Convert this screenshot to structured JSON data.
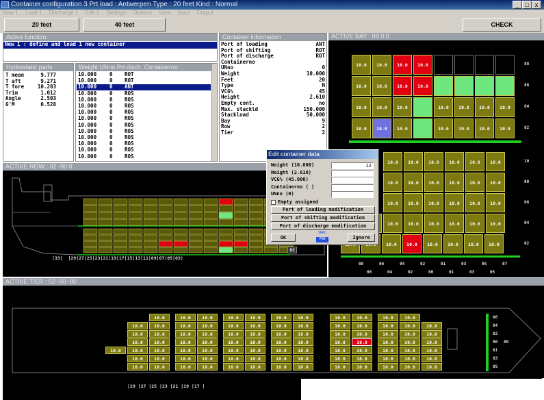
{
  "window": {
    "title": "Container configuration 3  Prt load : Antwerpen  Type : 20 feet  Kind : Normal",
    "controls": [
      "_",
      "□",
      "x"
    ]
  },
  "menu": [
    "New 1",
    "Load 1",
    "Discharge 1",
    "Edit 1",
    "Settings",
    "Options",
    "View",
    "Input",
    "Output"
  ],
  "toolbar": {
    "btn20": "20 feet",
    "btn40": "40 feet",
    "check": "CHECK"
  },
  "active_function": {
    "header": "Active function",
    "text": "New 1 : define and load 1 new container"
  },
  "hydro": {
    "header": "Hydrostatic parts",
    "rows": [
      {
        "k": "T mean",
        "v": "9.777"
      },
      {
        "k": "T aft",
        "v": "9.271"
      },
      {
        "k": "T fore",
        "v": "10.283"
      },
      {
        "k": "Trim",
        "v": "1.012"
      },
      {
        "k": "Angle",
        "v": "2.503"
      },
      {
        "k": "G'M",
        "v": "0.528"
      }
    ]
  },
  "weights": {
    "header": "Weight  UNno Prt disch. Containerno",
    "rows": [
      [
        "10.000",
        "0",
        "ROT"
      ],
      [
        "10.000",
        "0",
        "ROT"
      ],
      [
        "10.000",
        "0",
        "ANT"
      ],
      [
        "10.000",
        "0",
        "ROS"
      ],
      [
        "10.000",
        "0",
        "ROS"
      ],
      [
        "10.000",
        "0",
        "ROS"
      ],
      [
        "10.000",
        "0",
        "ROS"
      ],
      [
        "10.000",
        "0",
        "ROS"
      ],
      [
        "10.000",
        "0",
        "ROS"
      ],
      [
        "10.000",
        "0",
        "ROS"
      ],
      [
        "10.000",
        "0",
        "ROS"
      ],
      [
        "10.000",
        "0",
        "ROS"
      ],
      [
        "10.000",
        "0",
        "ROS"
      ],
      [
        "10.000",
        "0",
        "ROS"
      ]
    ],
    "selected_index": 2
  },
  "container_info": {
    "header": "Container information",
    "rows": [
      {
        "k": "Port of loading",
        "v": "ANT"
      },
      {
        "k": "Port of shifting",
        "v": "ROT"
      },
      {
        "k": "Port of discharge",
        "v": "ROT"
      },
      {
        "k": "Containerno",
        "v": ""
      },
      {
        "k": "UNno",
        "v": "0"
      },
      {
        "k": "Weight",
        "v": "10.000"
      },
      {
        "k": "Feet",
        "v": "20"
      },
      {
        "k": "Type",
        "v": "N"
      },
      {
        "k": "VCG%",
        "v": "45"
      },
      {
        "k": "Height",
        "v": "2.610"
      },
      {
        "k": "Empty cont.",
        "v": "no"
      },
      {
        "k": "Max. stackld",
        "v": "150.000"
      },
      {
        "k": "Stackload",
        "v": "50.000"
      },
      {
        "k": "Bay",
        "v": "9"
      },
      {
        "k": "Row",
        "v": "2"
      },
      {
        "k": "Tier",
        "v": "2"
      }
    ]
  },
  "active_bay": {
    "header": "ACTIVE BAY : 09        0  0",
    "deck_tiers": [
      "88",
      "86",
      "84",
      "82"
    ],
    "hold_tiers": [
      "10",
      "08",
      "06",
      "04",
      "02"
    ],
    "rows_top": [
      "08",
      "06",
      "04",
      "02",
      "01",
      "03",
      "05",
      "07"
    ],
    "rows_bottom": [
      "06",
      "04",
      "02",
      "00",
      "01",
      "03",
      "05"
    ]
  },
  "active_row": {
    "header": "ACTIVE ROW : 02      -90  0",
    "bays": "|33|  |29|27|25|23|21|19|17|15|13|11|09|07|05|03|",
    "side_label": "02"
  },
  "active_tier": {
    "header": "ACTIVE TIER : 02      -90 -90",
    "bays": "|29 |27 |25 |23 |21 |19 |17 |",
    "row_labels": [
      "06",
      "04",
      "02",
      "00",
      "01",
      "03",
      "05"
    ],
    "center_label": "88"
  },
  "dialog": {
    "title": "Edit container data",
    "fields": [
      {
        "label": "Weight (10.000)",
        "value": "12"
      },
      {
        "label": "Height (2.610)",
        "value": ""
      },
      {
        "label": "VCG% (45.000)",
        "value": ""
      },
      {
        "label": "Containerno ( )",
        "value": ""
      },
      {
        "label": "UNno (0)",
        "value": ""
      }
    ],
    "empty_label": "Empty assigned",
    "btn_loading": "Port of loading modification",
    "btn_shifting": "Port of shifting modification",
    "btn_discharge": "Port of discharge modification",
    "ok": "OK",
    "ignore": "Ignore",
    "badge_top": "SRRC",
    "badge_bottom": "PAN"
  },
  "cell_value": "10.0",
  "colors": {
    "container": "#7c7a10",
    "red": "#e00010",
    "green": "#6ee87e",
    "blue": "#7070e0",
    "header": "#9aa0a8"
  }
}
